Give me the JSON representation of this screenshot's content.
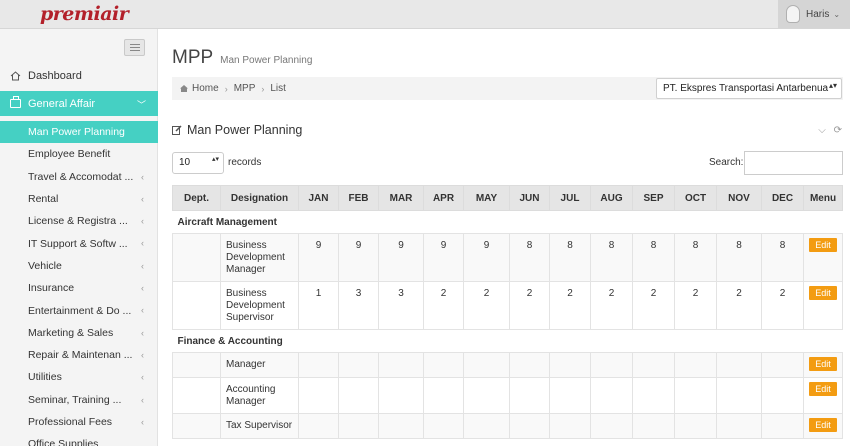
{
  "brand": {
    "logo_text": "premiair",
    "accent": "#45d0c3",
    "logo_color": "#b3202a"
  },
  "user": {
    "name": "Haris",
    "caret": "⌄"
  },
  "sidebar": {
    "dashboard": "Dashboard",
    "general_affair": "General Affair",
    "items": [
      {
        "label": "Man Power Planning",
        "active": true,
        "arrow": ""
      },
      {
        "label": "Employee Benefit",
        "arrow": ""
      },
      {
        "label": "Travel & Accomodat ...",
        "arrow": "‹"
      },
      {
        "label": "Rental",
        "arrow": "‹"
      },
      {
        "label": "License & Registra ...",
        "arrow": "‹"
      },
      {
        "label": "IT Support & Softw ...",
        "arrow": "‹"
      },
      {
        "label": "Vehicle",
        "arrow": "‹"
      },
      {
        "label": "Insurance",
        "arrow": "‹"
      },
      {
        "label": "Entertainment & Do ...",
        "arrow": "‹"
      },
      {
        "label": "Marketing & Sales",
        "arrow": "‹"
      },
      {
        "label": "Repair & Maintenan ...",
        "arrow": "‹"
      },
      {
        "label": "Utilities",
        "arrow": "‹"
      },
      {
        "label": "Seminar, Training ...",
        "arrow": "‹"
      },
      {
        "label": "Professional Fees",
        "arrow": "‹"
      },
      {
        "label": "Office Supplies",
        "arrow": ""
      }
    ]
  },
  "page": {
    "title": "MPP",
    "subtitle": "Man Power Planning"
  },
  "breadcrumb": {
    "home": "Home",
    "mpp": "MPP",
    "list": "List"
  },
  "company_select": {
    "value": "PT. Ekspres Transportasi Antarbenua",
    "caret": "▴▾"
  },
  "box": {
    "title": "Man Power Planning",
    "collapse_icon": "⌵",
    "refresh_icon": "⟳"
  },
  "table_controls": {
    "length_value": "10",
    "length_caret": "▴▾",
    "records_label": "records",
    "search_label": "Search:"
  },
  "table": {
    "headers": [
      "Dept.",
      "Designation",
      "JAN",
      "FEB",
      "MAR",
      "APR",
      "MAY",
      "JUN",
      "JUL",
      "AUG",
      "SEP",
      "OCT",
      "NOV",
      "DEC",
      "Menu"
    ],
    "edit_label": "Edit",
    "groups": [
      {
        "name": "Aircraft Management",
        "rows": [
          {
            "designation": "Business Development Manager",
            "months": [
              "9",
              "9",
              "9",
              "9",
              "9",
              "8",
              "8",
              "8",
              "8",
              "8",
              "8",
              "8"
            ]
          },
          {
            "designation": "Business Development Supervisor",
            "months": [
              "1",
              "3",
              "3",
              "2",
              "2",
              "2",
              "2",
              "2",
              "2",
              "2",
              "2",
              "2"
            ]
          }
        ]
      },
      {
        "name": "Finance & Accounting",
        "rows": [
          {
            "designation": "Manager",
            "months": [
              "",
              "",
              "",
              "",
              "",
              "",
              "",
              "",
              "",
              "",
              "",
              ""
            ]
          },
          {
            "designation": "Accounting Manager",
            "months": [
              "",
              "",
              "",
              "",
              "",
              "",
              "",
              "",
              "",
              "",
              "",
              ""
            ]
          },
          {
            "designation": "Tax Supervisor",
            "months": [
              "",
              "",
              "",
              "",
              "",
              "",
              "",
              "",
              "",
              "",
              "",
              ""
            ]
          }
        ]
      }
    ]
  }
}
